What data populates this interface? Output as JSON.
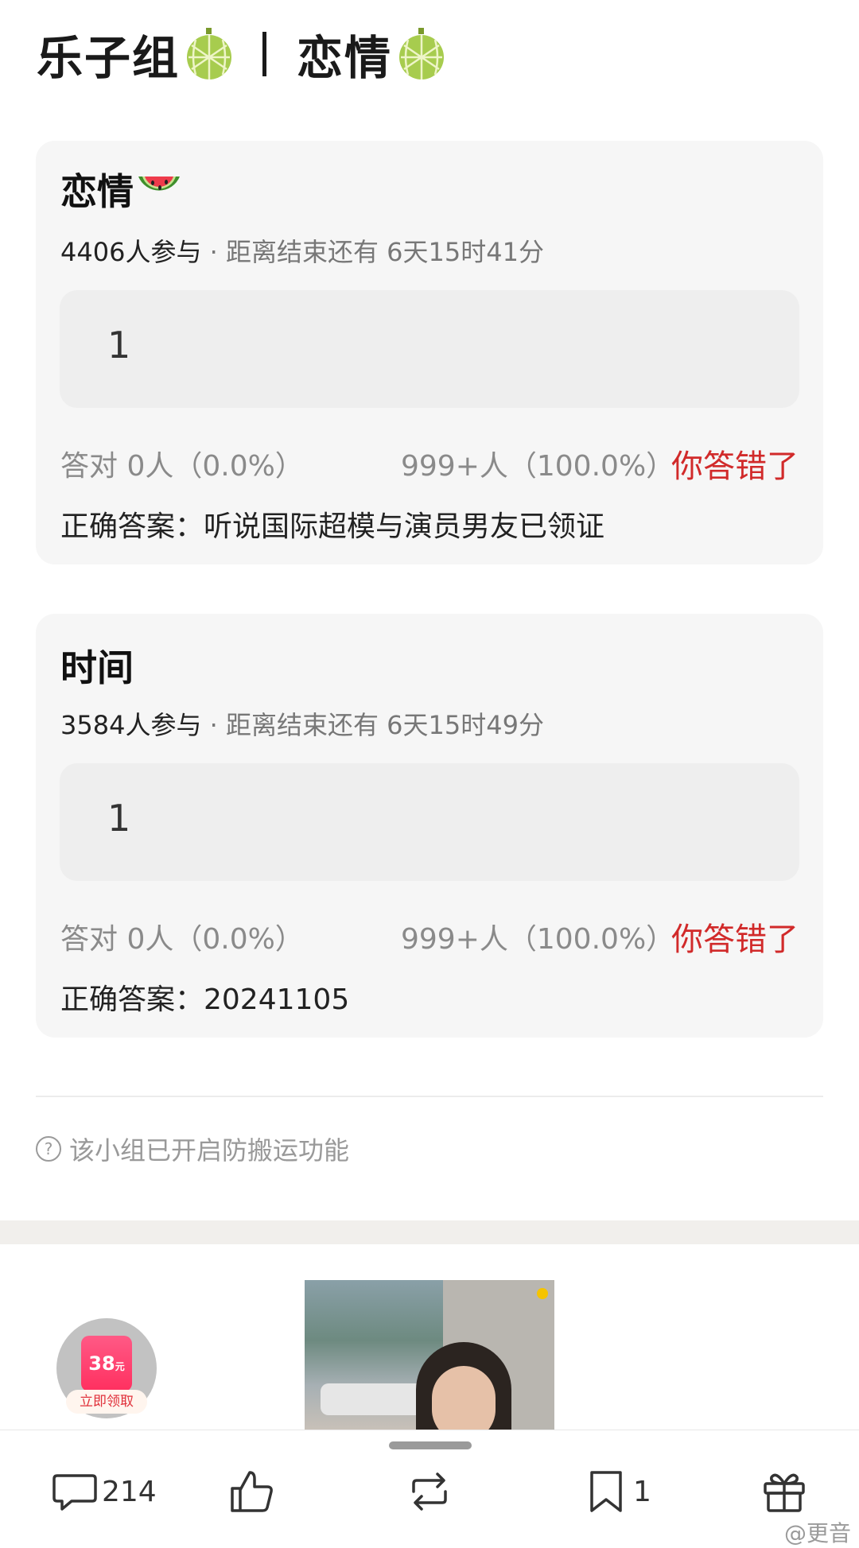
{
  "header": {
    "group": "乐子组",
    "topic": "恋情"
  },
  "polls": [
    {
      "title": "恋情",
      "participants": "4406人参与",
      "deadline": "· 距离结束还有 6天15时41分",
      "my_answer": "1",
      "correct_stat": "答对  0人（0.0%）",
      "wrong_stat": "999+人（100.0%）",
      "result": "你答错了",
      "correct_answer": "正确答案：听说国际超模与演员男友已领证"
    },
    {
      "title": "时间",
      "participants": "3584人参与",
      "deadline": "· 距离结束还有 6天15时49分",
      "my_answer": "1",
      "correct_stat": "答对  0人（0.0%）",
      "wrong_stat": "999+人（100.0%）",
      "result": "你答错了",
      "correct_answer": "正确答案：20241105"
    }
  ],
  "notice": "该小组已开启防搬运功能",
  "reward": {
    "amount": "38",
    "unit": "元",
    "claim": "立即领取"
  },
  "bottom_bar": {
    "comments": "214",
    "collect": "1"
  },
  "watermark": "@更音",
  "colors": {
    "card_bg": "#f6f6f6",
    "wrong_red": "#d12a2a"
  }
}
